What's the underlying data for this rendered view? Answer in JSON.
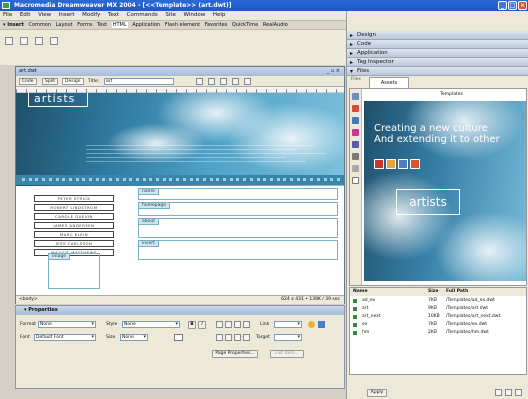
{
  "window": {
    "title": "Macromedia Dreamweaver MX 2004 - [<<Template>> (art.dwt)]"
  },
  "menu": [
    "File",
    "Edit",
    "View",
    "Insert",
    "Modify",
    "Text",
    "Commands",
    "Site",
    "Window",
    "Help"
  ],
  "insert_bar": [
    "▾ Insert",
    "Common",
    "Layout",
    "Forms",
    "Text",
    "HTML",
    "Application",
    "Flash element",
    "Favorites",
    "QuickTime",
    "RealAudio"
  ],
  "document": {
    "tab": "art.dwt",
    "view_buttons": [
      "Code",
      "Split",
      "Design"
    ],
    "title_label": "Title:",
    "title_value": "art",
    "banner": {
      "logo_text": "artists"
    },
    "names": [
      "PETER STRICK",
      "ROBERT LINDSTROM",
      "CAROLE GUEVIN",
      "JAMES ANDERSEN",
      "MARC KLEIN",
      "JESS CARLSSON",
      "MAGGIE MATTHEWS"
    ],
    "regions": {
      "name": "name",
      "homepage": "homepage",
      "about": "about",
      "insert": "insert",
      "image": "image"
    },
    "status": {
      "tag": "<body>",
      "size_info": "624 x 431 • 139K / 39 sec"
    }
  },
  "properties": {
    "title": "▾ Properties",
    "format_label": "Format",
    "format_value": "None",
    "style_label": "Style",
    "style_value": "None",
    "font_label": "Font",
    "font_value": "Default Font",
    "size_label": "Size",
    "size_value": "None",
    "link_label": "Link",
    "target_label": "Target",
    "bold": "B",
    "italic": "I",
    "page_properties_button": "Page Properties...",
    "list_item_button": "List Item..."
  },
  "panels": {
    "design": "Design",
    "code": "Code",
    "application": "Application",
    "tag_inspector": "Tag Inspector",
    "files": "Files",
    "tabs": [
      "Files",
      "Assets"
    ],
    "assets_header": "Templates",
    "preview": {
      "headline1": "Creating a new culture",
      "headline2": "And extending it to other",
      "logo_text": "artists"
    },
    "file_columns": [
      "Name",
      "Size",
      "Full Path"
    ],
    "files_list": [
      {
        "name": "ad_ex",
        "size": "7KB",
        "path": "/Templates/ad_ex.dwt"
      },
      {
        "name": "art",
        "size": "9KB",
        "path": "/Templates/art.dwt"
      },
      {
        "name": "art_next",
        "size": "10KB",
        "path": "/Templates/art_next.dwt"
      },
      {
        "name": "ex",
        "size": "7KB",
        "path": "/Templates/ex.dwt"
      },
      {
        "name": "hm",
        "size": "2KB",
        "path": "/Templates/hm.dwt"
      }
    ],
    "apply_button": "Apply"
  },
  "colors": {
    "title_blue": "#2058c4",
    "banner_dark": "#1f4f6a",
    "banner_light": "#7cc0dc",
    "region_border": "#7ab0c4",
    "panel_bg": "#ece9d8"
  }
}
